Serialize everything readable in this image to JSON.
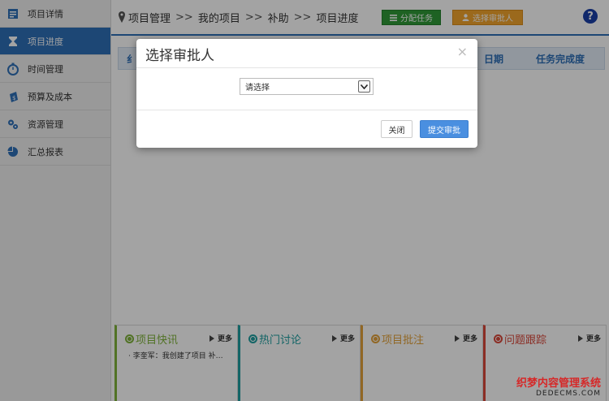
{
  "sidebar": {
    "items": [
      {
        "label": "项目详情",
        "icon": "document-icon"
      },
      {
        "label": "项目进度",
        "icon": "hourglass-icon"
      },
      {
        "label": "时间管理",
        "icon": "stopwatch-icon"
      },
      {
        "label": "预算及成本",
        "icon": "money-bag-icon"
      },
      {
        "label": "资源管理",
        "icon": "gears-icon"
      },
      {
        "label": "汇总报表",
        "icon": "pie-chart-icon"
      }
    ],
    "active_index": 1
  },
  "breadcrumb": {
    "items": [
      "项目管理",
      "我的项目",
      "补助",
      "项目进度"
    ],
    "separator": ">>"
  },
  "toolbar": {
    "assign_label": "分配任务",
    "approver_label": "选择审批人",
    "help_label": "?"
  },
  "table": {
    "headers_visible": [
      "纟",
      "日期",
      "任务完成度"
    ]
  },
  "panels": [
    {
      "title": "项目快讯",
      "more": "更多",
      "color": "#7fb33a",
      "item": "· 李奎军：我创建了项目 补…"
    },
    {
      "title": "热门讨论",
      "more": "更多",
      "color": "#1f9fa0",
      "item": ""
    },
    {
      "title": "项目批注",
      "more": "更多",
      "color": "#e3a23a",
      "item": ""
    },
    {
      "title": "问题跟踪",
      "more": "更多",
      "color": "#d9483b",
      "item": ""
    }
  ],
  "modal": {
    "title": "选择审批人",
    "close_symbol": "×",
    "select_value": "请选择",
    "close_button": "关闭",
    "submit_button": "提交审批"
  },
  "watermark": {
    "line1": "织梦内容管理系统",
    "line2": "DEDECMS.COM"
  },
  "colors": {
    "primary": "#2e6fb7",
    "assign": "#2f9a38",
    "approver": "#f2a52c",
    "submit": "#4a8fe0"
  }
}
